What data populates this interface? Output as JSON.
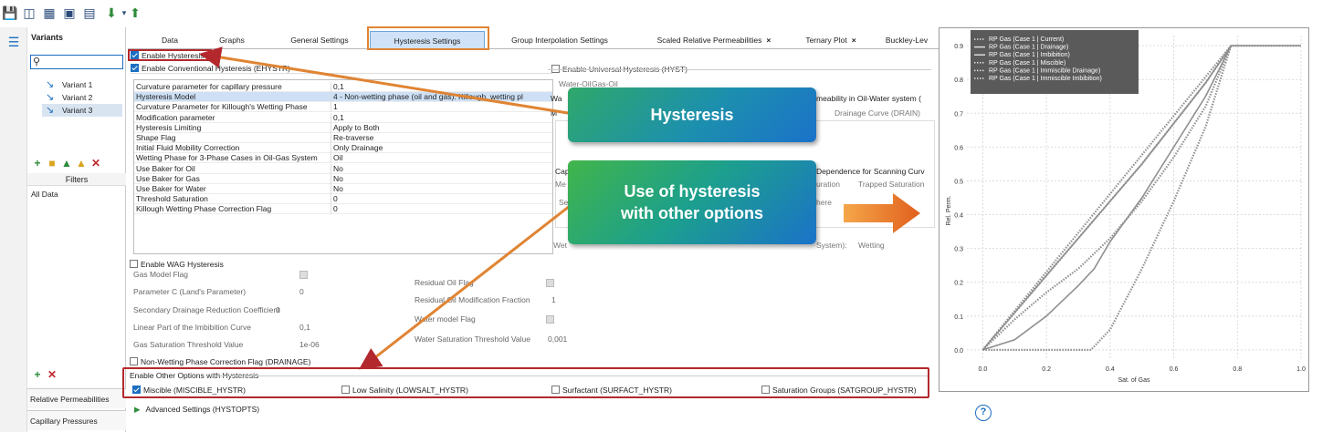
{
  "banner": {
    "text": "…y …ng … …"
  },
  "sidebar": {
    "header": "Variants",
    "variants": [
      "Variant 1",
      "Variant 2",
      "Variant 3"
    ],
    "selected_index": 2,
    "filters_header": "Filters",
    "filters_item": "All Data",
    "bottom_items": [
      "Relative Permeabilities",
      "Capillary Pressures"
    ]
  },
  "tabs": [
    {
      "label": "Data",
      "closable": false
    },
    {
      "label": "Graphs",
      "closable": false
    },
    {
      "label": "General Settings",
      "closable": false
    },
    {
      "label": "Hysteresis Settings",
      "closable": false,
      "active": true
    },
    {
      "label": "Group Interpolation Settings",
      "closable": false
    },
    {
      "label": "Scaled Relative Permeabilities",
      "closable": true
    },
    {
      "label": "Ternary Plot",
      "closable": true
    },
    {
      "label": "Buckley-Lev",
      "closable": false
    }
  ],
  "tab_close_glyph": "×",
  "hysteresis": {
    "enable_label": "Enable Hysteresis",
    "enable_checked": true,
    "conventional_label": "Enable Conventional Hysteresis (EHYSTR)",
    "conventional_checked": true,
    "params": [
      {
        "name": "Curvature parameter for capillary pressure",
        "value": "0,1"
      },
      {
        "name": "Hysteresis Model",
        "value": "4 - Non-wetting phase (oil and gas): Killough, wetting pl"
      },
      {
        "name": "Curvature Parameter for Killough's Wetting Phase",
        "value": "1"
      },
      {
        "name": "Modification parameter",
        "value": "0,1"
      },
      {
        "name": "Hysteresis Limiting",
        "value": "Apply to Both"
      },
      {
        "name": "Shape Flag",
        "value": "Re-traverse"
      },
      {
        "name": "Initial Fluid Mobility Correction",
        "value": "Only Drainage"
      },
      {
        "name": "Wetting Phase for 3-Phase Cases in Oil-Gas System",
        "value": "Oil"
      },
      {
        "name": "Use Baker for Oil",
        "value": "No"
      },
      {
        "name": "Use Baker for Gas",
        "value": "No"
      },
      {
        "name": "Use Baker for Water",
        "value": "No"
      },
      {
        "name": "Threshold Saturation",
        "value": "0"
      },
      {
        "name": "Killough Wetting Phase Correction Flag",
        "value": "0"
      }
    ],
    "selected_param_index": 1
  },
  "universal": {
    "label": "Enable Universal Hysteresis (HYST)",
    "tabs": [
      "Water-Oil",
      "Gas-Oil"
    ],
    "perm_title": "meability in Oil-Water system (",
    "drain_label": "Drainage Curve (DRAIN)",
    "wa": "Wa",
    "m": "M",
    "cap": "Cap",
    "me": "Me",
    "set": "Set",
    "dep_title": "Dependence for Scanning Curv",
    "scan_tabs": [
      "uration",
      "Trapped Saturation"
    ],
    "here": "here",
    "wet_left": "Wet",
    "wet_right": "System):",
    "wet_value": "Wetting"
  },
  "wag": {
    "label": "Enable WAG Hysteresis",
    "left": [
      {
        "name": "Gas Model Flag",
        "value": ""
      },
      {
        "name": "Parameter C (Land's Parameter)",
        "value": "0"
      },
      {
        "name": "Secondary Drainage Reduction Coefficient",
        "value": "0"
      },
      {
        "name": "Linear Part of the Imbibition Curve",
        "value": "0,1"
      },
      {
        "name": "Gas Saturation Threshold Value",
        "value": "1e-06"
      }
    ],
    "right": [
      {
        "name": "Residual Oil Flag",
        "value": ""
      },
      {
        "name": "Residual Oil Modification Fraction",
        "value": "1"
      },
      {
        "name": "Water model Flag",
        "value": ""
      },
      {
        "name": "Water Saturation Threshold Value",
        "value": "0,001"
      }
    ]
  },
  "nonwetting": {
    "label": "Non-Wetting Phase Correction Flag (DRAINAGE)"
  },
  "other_options": {
    "header": "Enable Other Options with Hysteresis",
    "items": [
      {
        "label": "Miscible (MISCIBLE_HYSTR)",
        "checked": true
      },
      {
        "label": "Low Salinity (LOWSALT_HYSTR)",
        "checked": false
      },
      {
        "label": "Surfactant (SURFACT_HYSTR)",
        "checked": false
      },
      {
        "label": "Saturation Groups (SATGROUP_HYSTR)",
        "checked": false
      }
    ]
  },
  "advanced": {
    "label": "Advanced Settings (HYSTOPTS)"
  },
  "callouts": {
    "hysteresis": "Hysteresis",
    "use_line1": "Use of hysteresis",
    "use_line2": "with other options"
  },
  "help_glyph": "?",
  "colors": {
    "accent": "#1b6ec2",
    "highlight_red": "#b3282d",
    "highlight_orange": "#e08433",
    "series": "#8f8f8f",
    "legend_bg": "#5a5a5a"
  },
  "icons": [
    "save-icon",
    "new-project-icon",
    "tree-icon",
    "puzzle-icon",
    "export-icon",
    "download-icon",
    "upload-icon",
    "variants-tree-icon"
  ],
  "chart_data": {
    "type": "line",
    "xlabel": "Sat. of Gas",
    "ylabel": "Rel. Perm.",
    "xlim": [
      -0.05,
      1.0
    ],
    "ylim": [
      -0.03,
      0.93
    ],
    "xticks": [
      "0.0",
      "0.2",
      "0.4",
      "0.6",
      "0.8",
      "1.0"
    ],
    "yticks": [
      "0.0",
      "0.1",
      "0.2",
      "0.3",
      "0.4",
      "0.5",
      "0.6",
      "0.7",
      "0.8",
      "0.9"
    ],
    "grid": true,
    "legend_position": "top-left",
    "series": [
      {
        "name": "RP Gas (Case 1 | Current)",
        "style": "dotted",
        "x": [
          0,
          0.78,
          1.0
        ],
        "y": [
          0,
          0.9,
          0.9
        ]
      },
      {
        "name": "RP Gas (Case 1 | Drainage)",
        "style": "solid",
        "x": [
          0,
          0.1,
          0.2,
          0.3,
          0.4,
          0.5,
          0.6,
          0.7,
          0.78,
          1.0
        ],
        "y": [
          0,
          0.11,
          0.22,
          0.33,
          0.44,
          0.55,
          0.67,
          0.79,
          0.9,
          0.9
        ]
      },
      {
        "name": "RP Gas (Case 1 | Imbibition)",
        "style": "solid",
        "x": [
          0,
          0.1,
          0.2,
          0.3,
          0.35,
          0.4,
          0.5,
          0.6,
          0.7,
          0.78
        ],
        "y": [
          0,
          0.03,
          0.1,
          0.19,
          0.24,
          0.32,
          0.45,
          0.6,
          0.75,
          0.9
        ]
      },
      {
        "name": "RP Gas (Case 1 | Miscible)",
        "style": "dotted",
        "x": [
          0,
          0.1,
          0.2,
          0.3,
          0.4,
          0.5,
          0.6,
          0.7,
          0.78
        ],
        "y": [
          0,
          0.09,
          0.17,
          0.24,
          0.33,
          0.44,
          0.57,
          0.72,
          0.9
        ]
      },
      {
        "name": "RP Gas (Case 1 | Immiscible Drainage)",
        "style": "dotted",
        "x": [
          0,
          0.1,
          0.2,
          0.3,
          0.4,
          0.5,
          0.6,
          0.7,
          0.78
        ],
        "y": [
          0,
          0.11,
          0.22,
          0.33,
          0.44,
          0.55,
          0.67,
          0.79,
          0.9
        ]
      },
      {
        "name": "RP Gas (Case 1 | Immiscible Imbibition)",
        "style": "dotted",
        "x": [
          0,
          0.2,
          0.34,
          0.4,
          0.5,
          0.6,
          0.7,
          0.78
        ],
        "y": [
          0,
          0,
          0,
          0.06,
          0.24,
          0.44,
          0.66,
          0.9
        ]
      }
    ]
  }
}
